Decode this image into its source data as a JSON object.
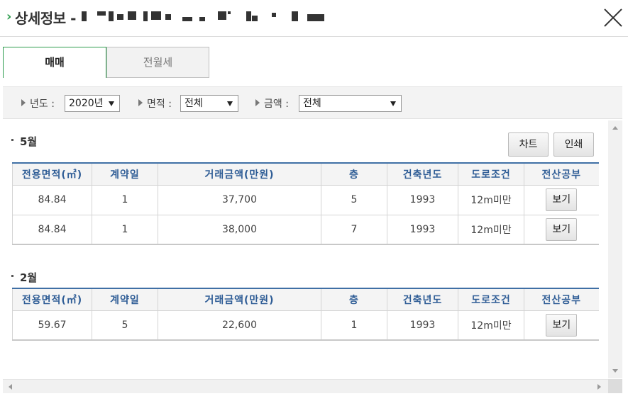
{
  "header": {
    "title": "상세정보 -",
    "close_icon": "close-icon"
  },
  "tabs": [
    {
      "label": "매매",
      "active": true
    },
    {
      "label": "전월세",
      "active": false
    }
  ],
  "filters": {
    "year": {
      "label": "년도 :",
      "value": "2020년"
    },
    "area": {
      "label": "면적 :",
      "value": "전체"
    },
    "price": {
      "label": "금액 :",
      "value": "전체"
    }
  },
  "buttons": {
    "chart": "차트",
    "print": "인쇄"
  },
  "columns": [
    "전용면적(㎡)",
    "계약일",
    "거래금액(만원)",
    "층",
    "건축년도",
    "도로조건",
    "전산공부"
  ],
  "months": [
    {
      "title": "5월",
      "rows": [
        {
          "area": "84.84",
          "day": "1",
          "price": "37,700",
          "floor": "5",
          "year": "1993",
          "road": "12m미만",
          "action": "보기"
        },
        {
          "area": "84.84",
          "day": "1",
          "price": "38,000",
          "floor": "7",
          "year": "1993",
          "road": "12m미만",
          "action": "보기"
        }
      ]
    },
    {
      "title": "2월",
      "rows": [
        {
          "area": "59.67",
          "day": "5",
          "price": "22,600",
          "floor": "1",
          "year": "1993",
          "road": "12m미만",
          "action": "보기"
        }
      ]
    }
  ]
}
